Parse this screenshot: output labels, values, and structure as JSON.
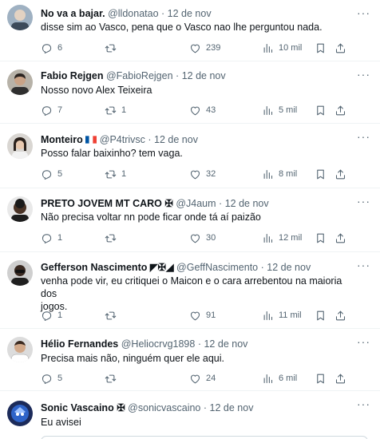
{
  "tweets": [
    {
      "name": "No va a bajar.",
      "flags": "",
      "handle": "@lldonatao",
      "dot": "·",
      "date": "12 de nov",
      "text": "disse sim ao Vasco, pena que o Vasco nao lhe perguntou nada.",
      "replies": "6",
      "retweets": "",
      "likes": "239",
      "views": "10 mil"
    },
    {
      "name": "Fabio Rejgen",
      "flags": "",
      "handle": "@FabioRejgen",
      "dot": "·",
      "date": "12 de nov",
      "text": "Nosso novo Alex Teixeira",
      "replies": "7",
      "retweets": "1",
      "likes": "43",
      "views": "5 mil"
    },
    {
      "name": "Monteiro",
      "flags": "",
      "handle": "@P4trivsc",
      "dot": "·",
      "date": "12 de nov",
      "text": "Posso falar baixinho? tem vaga.",
      "replies": "5",
      "retweets": "1",
      "likes": "32",
      "views": "8 mil"
    },
    {
      "name": "PRETO JOVEM MT CARO",
      "flags": "✠",
      "handle": "@J4aum",
      "dot": "·",
      "date": "12 de nov",
      "text": "Não precisa voltar nn pode ficar onde tá aí paizão",
      "replies": "1",
      "retweets": "",
      "likes": "30",
      "views": "12 mil"
    },
    {
      "name": "Gefferson Nascimento",
      "flags": "◤✠◢",
      "handle": "@GeffNascimento",
      "dot": "·",
      "date": "12 de nov",
      "text_line1": "venha pode vir, eu critiquei o Maicon e o cara arrebentou na maioria dos",
      "text_line2": "jogos.",
      "replies": "1",
      "retweets": "",
      "likes": "91",
      "views": "11 mil"
    },
    {
      "name": "Hélio Fernandes",
      "flags": "",
      "handle": "@Heliocrvg1898",
      "dot": "·",
      "date": "12 de nov",
      "text": "Precisa mais não, ninguém quer ele aqui.",
      "replies": "5",
      "retweets": "",
      "likes": "24",
      "views": "6 mil"
    },
    {
      "name": "Sonic Vascaino",
      "flags": "✠",
      "handle": "@sonicvascaino",
      "dot": "·",
      "date": "12 de nov",
      "text": "Eu avisei"
    }
  ],
  "icons": {
    "reply": "reply-icon",
    "retweet": "retweet-icon",
    "like": "heart-icon",
    "views": "views-icon",
    "bookmark": "bookmark-icon",
    "share": "share-icon",
    "more": "more-icon"
  },
  "colors": {
    "text": "#0f1419",
    "muted": "#536471",
    "divider": "#eff3f4"
  }
}
